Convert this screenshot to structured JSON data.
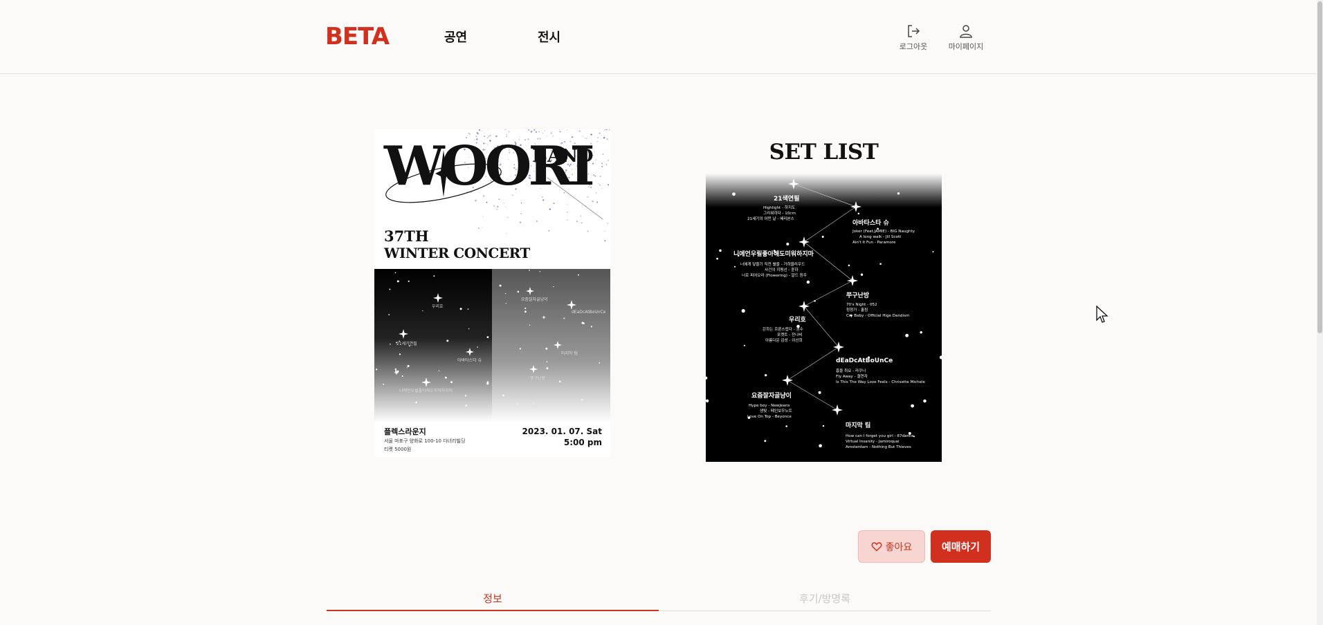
{
  "header": {
    "logo": "BETA",
    "nav": [
      "공연",
      "전시"
    ],
    "logout_label": "로그아웃",
    "mypage_label": "마이페이지",
    "logout_icon": "logout-icon",
    "mypage_icon": "user-icon"
  },
  "poster": {
    "wordmark": "WOORI",
    "band": "BAND",
    "edition": "37TH",
    "concert": "WINTER CONCERT",
    "venue": "플렉스라운지",
    "address": "서울 마포구 양화로 100-10 다녀리빌딩",
    "ticket": "티켓 5000원",
    "date": "2023. 01. 07. Sat",
    "time": "5:00 pm",
    "star_labels": [
      "우리호",
      "21세기연필",
      "아바타스타 슈",
      "니에언우릴좋아해도미워하지마",
      "요즘잘자골냥이",
      "dEaDcAtBoUnCe",
      "마지막 팀",
      "쭈구난방"
    ]
  },
  "setlist": {
    "title": "SET LIST",
    "groups": [
      {
        "name": "21색연필",
        "songs": [
          "Highlight - 하지도",
          "그리워하다 - 10cm",
          "21세기의 어떤 날 - 혜리본스"
        ]
      },
      {
        "name": "아바타스타 슈",
        "songs": [
          "Joker (Feat.JAMIE) - BIG Naughty",
          "A long walk - Jill Scott",
          "Ain't It Fun - Paramore"
        ]
      },
      {
        "name": "니에언우릴좋아해도미워하지마",
        "songs": [
          "너에게 닿을기 직전 별을 - 가하블리우드",
          "사건의 지평선 - 윤하",
          "너로 피어오라 (Flowering) - 알드 원주"
        ]
      },
      {
        "name": "쭈구난방",
        "songs": [
          "70's Night - 052",
          "청청가 - 홀림",
          "Cry Baby - Official Hige Dandism"
        ]
      },
      {
        "name": "우리호",
        "songs": [
          "은하는 흐른스럽다 - 권수",
          "포켓트 - 잔나비",
          "아름다운 감성 - 이선희"
        ]
      },
      {
        "name": "dEaDcAtBoUnCe",
        "songs": [
          "흡을 취요 - 라쿠나",
          "Fly Away - 결연자",
          "Is This The Way Love Feels - Chrisette Michele"
        ]
      },
      {
        "name": "요즘잘자골냥이",
        "songs": [
          "Hype boy - NewJeans",
          "생빛 - 페인보우노트",
          "Love On Top - Beyonce"
        ]
      },
      {
        "name": "마지막 팀",
        "songs": [
          "How can I forget you girl - 87dance",
          "Virtual Insanity - Jamiroquai",
          "Amsterdam - Nothing But Thieves"
        ]
      }
    ]
  },
  "actions": {
    "like_label": "좋아요",
    "like_icon": "heart-icon",
    "book_label": "예매하기"
  },
  "tabs": [
    "정보",
    "후기/방명록"
  ],
  "colors": {
    "brand": "#d2301e",
    "like_bg": "#f7d6d2",
    "background": "#fbfaf8"
  }
}
